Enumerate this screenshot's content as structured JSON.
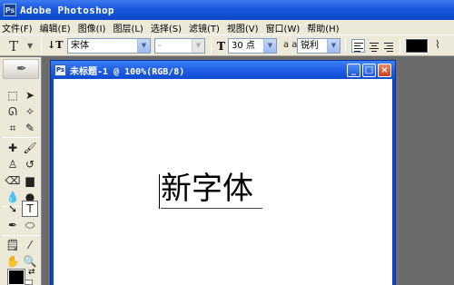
{
  "app": {
    "title": "Adobe Photoshop",
    "icon_text": "Ps"
  },
  "menu": {
    "items": [
      {
        "label": "文件(F)"
      },
      {
        "label": "编辑(E)"
      },
      {
        "label": "图像(I)"
      },
      {
        "label": "图层(L)"
      },
      {
        "label": "选择(S)"
      },
      {
        "label": "滤镜(T)"
      },
      {
        "label": "视图(V)"
      },
      {
        "label": "窗口(W)"
      },
      {
        "label": "帮助(H)"
      }
    ]
  },
  "options": {
    "tool_icon": "T",
    "orientation_icon": "↓T",
    "font_family": "宋体",
    "font_style": "-",
    "size_icon": "T",
    "font_size": "30 点",
    "aa_label": "a a",
    "antialias": "锐利",
    "text_color": "#000000"
  },
  "document": {
    "title": "未标题-1 @ 100%(RGB/8)",
    "icon_text": "Ps",
    "minimize": "_",
    "maximize": "□",
    "close": "×",
    "canvas_text": "新字体"
  },
  "colors": {
    "titlebar": "#0a47c8",
    "chrome": "#ece9d8",
    "workspace": "#6b6b6b",
    "foreground": "#000000",
    "background": "#ffffff"
  }
}
